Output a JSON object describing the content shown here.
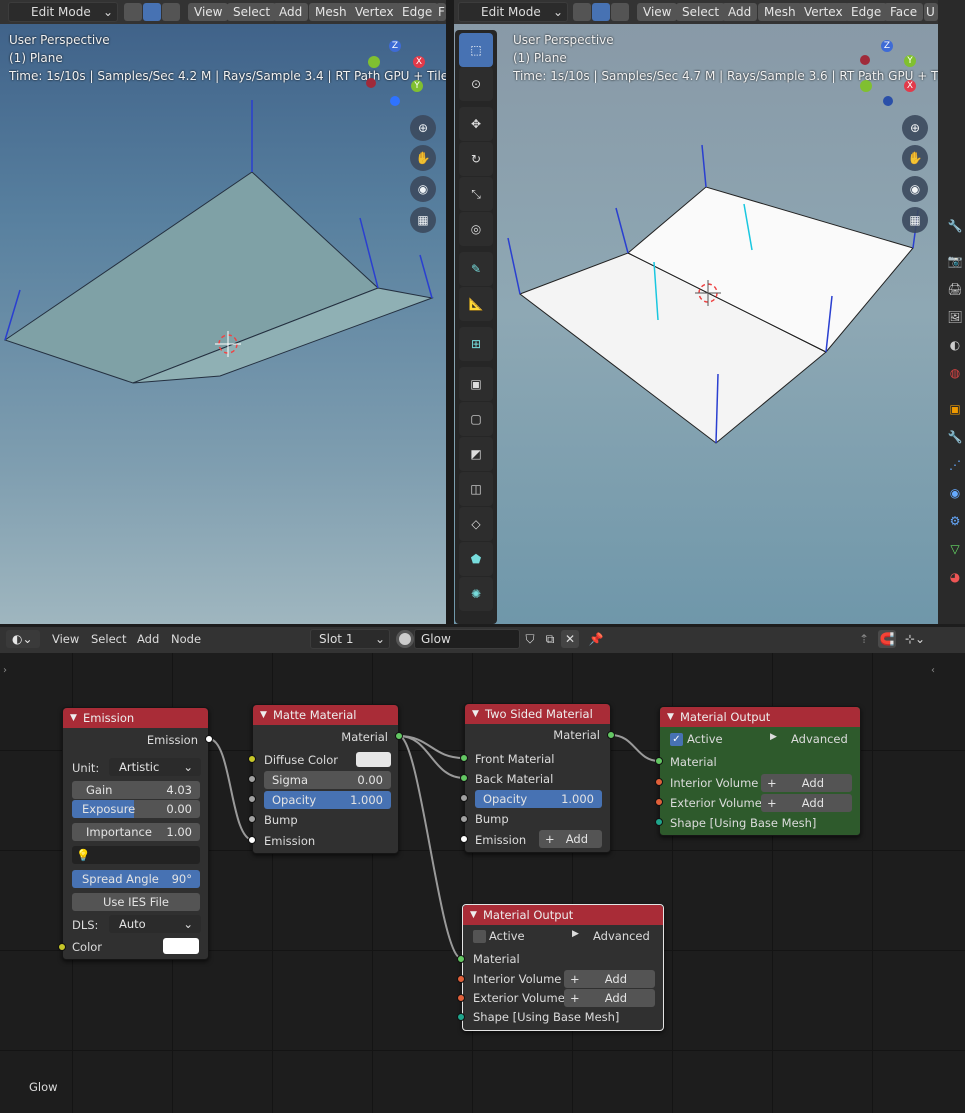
{
  "viewport_left": {
    "mode": "Edit Mode",
    "menu": [
      "View",
      "Select",
      "Add",
      "Mesh",
      "Vertex",
      "Edge",
      "F"
    ],
    "perspective": "User Perspective",
    "object": "(1) Plane",
    "stats": "Time: 1s/10s | Samples/Sec 4.2 M | Rays/Sample 3.4 | RT Path GPU + Tile Path Sampler |",
    "gizmo": {
      "x": "X",
      "y": "Y",
      "z": "Z"
    }
  },
  "viewport_right": {
    "mode": "Edit Mode",
    "menu": [
      "View",
      "Select",
      "Add",
      "Mesh",
      "Vertex",
      "Edge",
      "Face",
      "U"
    ],
    "perspective": "User Perspective",
    "object": "(1) Plane",
    "stats": "Time: 1s/10s | Samples/Sec 4.7 M | Rays/Sample 3.6 | RT Path GPU + Tile Path Sample",
    "gizmo": {
      "x": "X",
      "y": "Y",
      "z": "Z"
    }
  },
  "node_header": {
    "menu": [
      "View",
      "Select",
      "Add",
      "Node"
    ],
    "slot": "Slot 1",
    "material": "Glow"
  },
  "nodes": {
    "emission": {
      "title": "Emission",
      "out_emission": "Emission",
      "unit_label": "Unit:",
      "unit_value": "Artistic",
      "gain_label": "Gain",
      "gain_value": "4.03",
      "exposure_label": "Exposure",
      "exposure_value": "0.00",
      "importance_label": "Importance",
      "importance_value": "1.00",
      "spread_label": "Spread Angle",
      "spread_value": "90°",
      "ies_button": "Use IES File",
      "dls_label": "DLS:",
      "dls_value": "Auto",
      "color_label": "Color",
      "color_value": "#ffffff"
    },
    "matte": {
      "title": "Matte Material",
      "out_material": "Material",
      "diffuse_label": "Diffuse Color",
      "diffuse_value": "#e6e6e6",
      "sigma_label": "Sigma",
      "sigma_value": "0.00",
      "opacity_label": "Opacity",
      "opacity_value": "1.000",
      "bump_label": "Bump",
      "emission_label": "Emission"
    },
    "two_sided": {
      "title": "Two Sided Material",
      "out_material": "Material",
      "front_label": "Front Material",
      "back_label": "Back Material",
      "opacity_label": "Opacity",
      "opacity_value": "1.000",
      "bump_label": "Bump",
      "emission_label": "Emission",
      "add_label": "Add"
    },
    "output_active": {
      "title": "Material Output",
      "active_label": "Active",
      "advanced_label": "Advanced",
      "material_label": "Material",
      "interior_label": "Interior Volume",
      "exterior_label": "Exterior Volume",
      "add_label": "Add",
      "shape_label": "Shape [Using Base Mesh]"
    },
    "output_inactive": {
      "title": "Material Output",
      "active_label": "Active",
      "advanced_label": "Advanced",
      "material_label": "Material",
      "interior_label": "Interior Volume",
      "exterior_label": "Exterior Volume",
      "add_label": "Add",
      "shape_label": "Shape [Using Base Mesh]"
    }
  },
  "footer_label": "Glow",
  "colors": {
    "node_header_red": "#a92c37",
    "output_active_body": "#2e5a2c",
    "socket_yellow": "#c7c729",
    "socket_gray": "#a1a1a1",
    "socket_green": "#63c763",
    "socket_orange": "#e0603a",
    "socket_teal": "#1fa58c",
    "accent_blue": "#4772b3"
  }
}
